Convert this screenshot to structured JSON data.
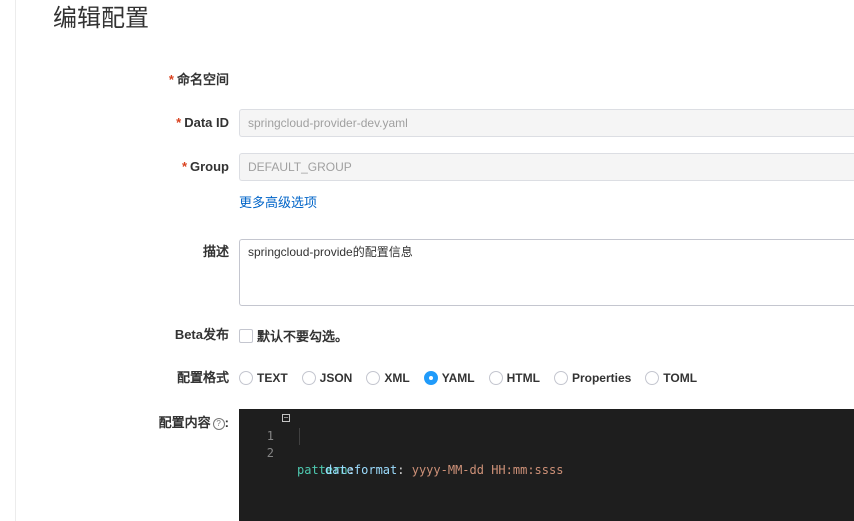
{
  "page": {
    "title": "编辑配置"
  },
  "form": {
    "namespace": {
      "label": "命名空间",
      "required_mark": "*"
    },
    "data_id": {
      "label": "Data ID",
      "required_mark": "*",
      "value": "springcloud-provider-dev.yaml"
    },
    "group": {
      "label": "Group",
      "required_mark": "*",
      "value": "DEFAULT_GROUP"
    },
    "advanced_link": "更多高级选项",
    "description": {
      "label": "描述",
      "value": "springcloud-provide的配置信息"
    },
    "beta": {
      "label": "Beta发布",
      "hint": "默认不要勾选。",
      "checked": false
    },
    "format": {
      "label": "配置格式",
      "options": [
        "TEXT",
        "JSON",
        "XML",
        "YAML",
        "HTML",
        "Properties",
        "TOML"
      ],
      "selected": "YAML"
    },
    "content": {
      "label": "配置内容",
      "help_glyph": "?",
      "colon": ":",
      "lines": [
        {
          "num": "1",
          "key": "pattern",
          "sep": ":",
          "value": ""
        },
        {
          "num": "2",
          "key": "dateformat",
          "sep": ":",
          "value": "yyyy-MM-dd HH:mm:ssss"
        }
      ]
    }
  }
}
